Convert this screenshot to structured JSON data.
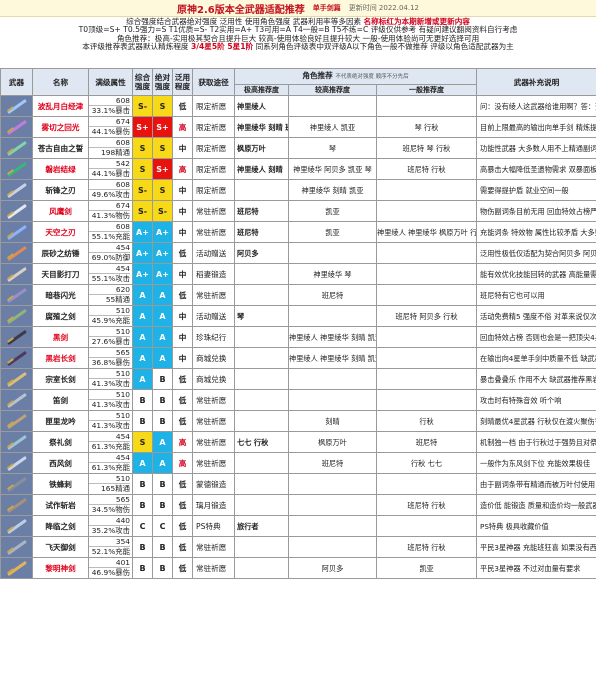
{
  "header": {
    "title": "原神2.6版本全武器适配推荐",
    "subtitle": "单手剑篇",
    "date_label": "更新时间 2022.04.12"
  },
  "notes": {
    "line1_prefix": "综合强度结合武器绝对强度 泛用性 使用角色强度 武器利用率等多因素",
    "line1_red": "名称标红为本期新增或更新内容",
    "line2": "T0顶级=S+ T0.5强力=S T1优质=S- T2实用=A+ T3可用=A T4一般=B T5不练=C 评级仅供参考 有疑问建议翻阅资料自行考虑",
    "line3": "角色推荐：极高-实用极其契合且提升巨大 较高-使用体验良好且提升较大 一般-使用体验尚可无更好选择可用",
    "line4_prefix": "本评级推荐表武器默认精炼程度",
    "line4_red": "3/4星5阶 5星1阶",
    "line4_suffix": "同系列角色评级表中双评级A以下角色一般不做推荐 评级以角色适配武器为主"
  },
  "columns": {
    "weapon": "武器",
    "name": "名称",
    "stat": "满级属性",
    "overall": "综合强度",
    "absolute": "绝对强度",
    "utility": "泛用程度",
    "source": "获取途径",
    "roles": "角色推荐",
    "roles_note": "不代表绝对强度 顺序不分先后",
    "role_high": "极高推荐度",
    "role_mid": "较高推荐度",
    "role_low": "一般推荐度",
    "desc": "武器补充说明"
  },
  "rows": [
    {
      "name": "波乱月白经津",
      "red": true,
      "atk": "608",
      "sub": "33.1%暴击",
      "overall": "S-",
      "overall_t": "t-Sm",
      "absolute": "S",
      "absolute_t": "t-S",
      "utility": "低",
      "source": "限定祈愿",
      "high": "神里绫人",
      "mid": "",
      "low": "",
      "desc": "问：没有绫人这武器给谁用啊？答：查无此人",
      "blade": "#9ec8ff"
    },
    {
      "name": "雾切之回光",
      "red": true,
      "atk": "674",
      "sub": "44.1%暴伤",
      "overall": "S+",
      "overall_t": "t-Sp",
      "absolute": "S+",
      "absolute_t": "t-Sp",
      "utility": "高",
      "source": "限定祈愿",
      "high": "神里绫华 刻晴 班尼特",
      "mid": "神里绫人 凯亚",
      "low": "琴 行秋",
      "desc": "目前上限最高的输出向单手剑 精炼提升巨大 基础属性加成 班尼特可以用",
      "blade": "#c47be0"
    },
    {
      "name": "苍古自由之誓",
      "red": false,
      "atk": "608",
      "sub": "198精通",
      "overall": "S",
      "overall_t": "t-S",
      "absolute": "S",
      "absolute_t": "t-S",
      "utility": "中",
      "source": "限定祈愿",
      "high": "枫原万叶",
      "mid": "琴",
      "low": "班尼特 琴 行秋",
      "desc": "功能性武器 大多数人用不上精通副词条 大多数人建议珍藏 堪用都能很好用",
      "blade": "#7fd6a8"
    },
    {
      "name": "磐岩结绿",
      "red": true,
      "atk": "542",
      "sub": "44.1%暴击",
      "overall": "S",
      "overall_t": "t-S",
      "absolute": "S+",
      "absolute_t": "t-Sp",
      "utility": "高",
      "source": "限定祈愿",
      "high": "神里绫人 刻晴",
      "mid": "神里绫华 阿贝多 凯亚 琴",
      "low": "班尼特 行秋",
      "desc": "高暴击大幅降低圣遗物需求 双暴面板轻松毕业能带各大主C",
      "blade": "#37b87a"
    },
    {
      "name": "斩锋之刃",
      "red": false,
      "atk": "608",
      "sub": "49.6%攻击",
      "overall": "S-",
      "overall_t": "t-Sm",
      "absolute": "S",
      "absolute_t": "t-S",
      "utility": "中",
      "source": "限定祈愿",
      "high": "",
      "mid": "神里绫华 刻晴 凯亚",
      "low": "",
      "desc": "需要得提护盾 就业空间一般",
      "blade": "#c9d2e4"
    },
    {
      "name": "风鹰剑",
      "red": true,
      "atk": "674",
      "sub": "41.3%物伤",
      "overall": "S-",
      "overall_t": "t-Sm",
      "absolute": "S-",
      "absolute_t": "t-Sm",
      "utility": "中",
      "source": "常驻祈愿",
      "high": "班尼特",
      "mid": "凯亚",
      "low": "",
      "desc": "物伤副词条目前无用 回血特效占榜严重 不过高攻击属性依然有效",
      "blade": "#e3e7ee"
    },
    {
      "name": "天空之刃",
      "red": true,
      "atk": "608",
      "sub": "55.1%充能",
      "overall": "A+",
      "overall_t": "t-Ap",
      "absolute": "A+",
      "absolute_t": "t-Ap",
      "utility": "中",
      "source": "常驻祈愿",
      "high": "班尼特",
      "mid": "凯亚",
      "low": "神里绫人 神里绫华 枫原万叶 行秋",
      "desc": "充能词条 特效物 属性比较矛盾 大多数情况都暴击副c或辅助回转用",
      "blade": "#8ab4ff"
    },
    {
      "name": "辰砂之纺锤",
      "red": false,
      "atk": "454",
      "sub": "69.0%防御",
      "overall": "A+",
      "overall_t": "t-Ap",
      "absolute": "A+",
      "absolute_t": "t-Ap",
      "utility": "低",
      "source": "活动赠送",
      "high": "阿贝多",
      "mid": "",
      "low": "",
      "desc": "泛用性极低仅适配为契合阿贝多 阿贝多玩家的福音",
      "blade": "#e08a5a"
    },
    {
      "name": "天目影打刀",
      "red": false,
      "atk": "454",
      "sub": "55.1%攻击",
      "overall": "A+",
      "overall_t": "t-Ap",
      "absolute": "A+",
      "absolute_t": "t-Ap",
      "utility": "中",
      "source": "稻妻锻造",
      "high": "",
      "mid": "神里绫华 琴",
      "low": "",
      "desc": "能有效优化技能回转的武器 高能量需求角色狂欢",
      "blade": "#d9d0c4"
    },
    {
      "name": "暗巷闪光",
      "red": false,
      "atk": "620",
      "sub": "55精通",
      "overall": "A",
      "overall_t": "t-A",
      "absolute": "A",
      "absolute_t": "t-A",
      "utility": "低",
      "source": "常驻祈愿",
      "high": "",
      "mid": "班尼特",
      "low": "",
      "desc": "班尼特有它也可以用",
      "blade": "#9a8fc9"
    },
    {
      "name": "腐殖之剑",
      "red": false,
      "atk": "510",
      "sub": "45.9%充能",
      "overall": "A",
      "overall_t": "t-A",
      "absolute": "A",
      "absolute_t": "t-A",
      "utility": "中",
      "source": "活动赠送",
      "high": "琴",
      "mid": "",
      "low": "班尼特 阿贝多 行秋",
      "desc": "活动免费精5 强度不俗 对革来说仅次于要切与绿剑",
      "blade": "#8fb57a"
    },
    {
      "name": "黑剑",
      "red": true,
      "atk": "510",
      "sub": "27.6%暴击",
      "overall": "A",
      "overall_t": "t-A",
      "absolute": "A",
      "absolute_t": "t-A",
      "utility": "中",
      "source": "珍珠纪行",
      "high": "",
      "mid": "神里绫人 神里绫华 刻晴 凯亚",
      "low": "",
      "desc": "回血特效占榜 否则也会是一把顶尖4星武器",
      "blade": "#3a3a4a"
    },
    {
      "name": "黑岩长剑",
      "red": true,
      "atk": "565",
      "sub": "36.8%暴伤",
      "overall": "A",
      "overall_t": "t-A",
      "absolute": "A",
      "absolute_t": "t-A",
      "utility": "中",
      "source": "商城兑换",
      "high": "",
      "mid": "神里绫人 神里绫华 刻晴 凯亚",
      "low": "",
      "desc": "在输出向4星单手剑中质量不低 缺武器可以考虑换一把 特效不稳定",
      "blade": "#4b3a5e"
    },
    {
      "name": "宗室长剑",
      "red": false,
      "atk": "510",
      "sub": "41.3%攻击",
      "overall": "A",
      "overall_t": "t-A",
      "absolute": "B",
      "absolute_t": "t-B",
      "utility": "低",
      "source": "商城兑换",
      "high": "",
      "mid": "",
      "low": "",
      "desc": "暴击叠叠乐 作用不大 缺武器推荐黑岩",
      "blade": "#d9c07a"
    },
    {
      "name": "笛剑",
      "red": false,
      "atk": "510",
      "sub": "41.3%攻击",
      "overall": "B",
      "overall_t": "t-B",
      "absolute": "B",
      "absolute_t": "t-B",
      "utility": "低",
      "source": "常驻祈愿",
      "high": "",
      "mid": "",
      "low": "",
      "desc": "攻击时有特殊音效 听个响",
      "blade": "#b9c2d0"
    },
    {
      "name": "匣里龙吟",
      "red": false,
      "atk": "510",
      "sub": "41.3%攻击",
      "overall": "B",
      "overall_t": "t-B",
      "absolute": "B",
      "absolute_t": "t-B",
      "utility": "低",
      "source": "常驻祈愿",
      "high": "",
      "mid": "刻晴",
      "low": "行秋",
      "desc": "刻晴最优4星武器 行秋仅在渡火聚伤害时可用 日常不推荐",
      "blade": "#c0a27a"
    },
    {
      "name": "祭礼剑",
      "red": false,
      "atk": "454",
      "sub": "61.3%充能",
      "overall": "S",
      "overall_t": "t-S",
      "absolute": "A",
      "absolute_t": "t-A",
      "utility": "高",
      "source": "常驻祈愿",
      "high": "七七 行秋",
      "mid": "枫原万叶",
      "low": "班尼特",
      "desc": "机制独一档 由于行秋过于强势且对祭礼剑需求高 短期内都会是顶尖行秋",
      "blade": "#9cc5d8"
    },
    {
      "name": "西风剑",
      "red": false,
      "atk": "454",
      "sub": "61.3%充能",
      "overall": "A",
      "overall_t": "t-A",
      "absolute": "A",
      "absolute_t": "t-A",
      "utility": "高",
      "source": "常驻祈愿",
      "high": "",
      "mid": "班尼特",
      "low": "行秋 七七",
      "desc": "一般作为东风剑下位 充能效果极佳",
      "blade": "#c9d7e8"
    },
    {
      "name": "铁蜂刺",
      "red": false,
      "atk": "510",
      "sub": "165精通",
      "overall": "B",
      "overall_t": "t-B",
      "absolute": "B",
      "absolute_t": "t-B",
      "utility": "低",
      "source": "蒙德锻造",
      "high": "",
      "mid": "",
      "low": "",
      "desc": "由于副词条带有精通而被万叶付使用",
      "blade": "#8a8f99"
    },
    {
      "name": "试作斩岩",
      "red": false,
      "atk": "565",
      "sub": "34.5%物伤",
      "overall": "B",
      "overall_t": "t-B",
      "absolute": "B",
      "absolute_t": "t-B",
      "utility": "低",
      "source": "璃月锻造",
      "high": "",
      "mid": "",
      "low": "班尼特 行秋",
      "desc": "造价低 能锻造 质量和造价均一般武器 用 不至于换黑岩给他吧",
      "blade": "#a6927a"
    },
    {
      "name": "降临之剑",
      "red": false,
      "atk": "440",
      "sub": "35.2%攻击",
      "overall": "C",
      "overall_t": "t-C",
      "absolute": "C",
      "absolute_t": "t-C",
      "utility": "低",
      "source": "PS特典",
      "high": "旅行者",
      "mid": "",
      "low": "",
      "desc": "PS特典 极具收藏价值",
      "blade": "#b9cfe6"
    },
    {
      "name": "飞天御剑",
      "red": false,
      "atk": "354",
      "sub": "52.1%充能",
      "overall": "B",
      "overall_t": "t-B",
      "absolute": "B",
      "absolute_t": "t-B",
      "utility": "低",
      "source": "常驻祈愿",
      "high": "",
      "mid": "",
      "low": "班尼特 行秋",
      "desc": "平民3星神器 充能班狂喜 如果没有西风剑那就用它吧 不会让你失望",
      "blade": "#a9b6c4"
    },
    {
      "name": "黎明神剑",
      "red": true,
      "atk": "401",
      "sub": "46.9%暴伤",
      "overall": "B",
      "overall_t": "t-B",
      "absolute": "B",
      "absolute_t": "t-B",
      "utility": "低",
      "source": "常驻祈愿",
      "high": "",
      "mid": "阿贝多",
      "low": "凯亚",
      "desc": "平民3星神器 不过对血量有要求",
      "blade": "#e6b35a"
    }
  ]
}
